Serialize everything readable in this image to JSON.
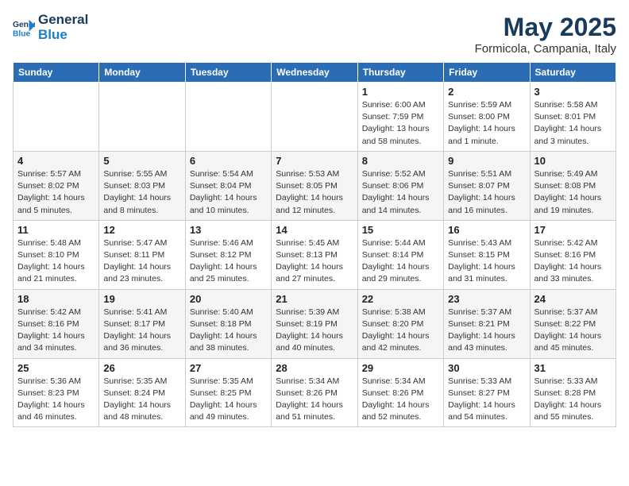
{
  "header": {
    "logo_text_general": "General",
    "logo_text_blue": "Blue",
    "month": "May 2025",
    "location": "Formicola, Campania, Italy"
  },
  "days_of_week": [
    "Sunday",
    "Monday",
    "Tuesday",
    "Wednesday",
    "Thursday",
    "Friday",
    "Saturday"
  ],
  "weeks": [
    [
      {
        "num": "",
        "info": ""
      },
      {
        "num": "",
        "info": ""
      },
      {
        "num": "",
        "info": ""
      },
      {
        "num": "",
        "info": ""
      },
      {
        "num": "1",
        "info": "Sunrise: 6:00 AM\nSunset: 7:59 PM\nDaylight: 13 hours\nand 58 minutes."
      },
      {
        "num": "2",
        "info": "Sunrise: 5:59 AM\nSunset: 8:00 PM\nDaylight: 14 hours\nand 1 minute."
      },
      {
        "num": "3",
        "info": "Sunrise: 5:58 AM\nSunset: 8:01 PM\nDaylight: 14 hours\nand 3 minutes."
      }
    ],
    [
      {
        "num": "4",
        "info": "Sunrise: 5:57 AM\nSunset: 8:02 PM\nDaylight: 14 hours\nand 5 minutes."
      },
      {
        "num": "5",
        "info": "Sunrise: 5:55 AM\nSunset: 8:03 PM\nDaylight: 14 hours\nand 8 minutes."
      },
      {
        "num": "6",
        "info": "Sunrise: 5:54 AM\nSunset: 8:04 PM\nDaylight: 14 hours\nand 10 minutes."
      },
      {
        "num": "7",
        "info": "Sunrise: 5:53 AM\nSunset: 8:05 PM\nDaylight: 14 hours\nand 12 minutes."
      },
      {
        "num": "8",
        "info": "Sunrise: 5:52 AM\nSunset: 8:06 PM\nDaylight: 14 hours\nand 14 minutes."
      },
      {
        "num": "9",
        "info": "Sunrise: 5:51 AM\nSunset: 8:07 PM\nDaylight: 14 hours\nand 16 minutes."
      },
      {
        "num": "10",
        "info": "Sunrise: 5:49 AM\nSunset: 8:08 PM\nDaylight: 14 hours\nand 19 minutes."
      }
    ],
    [
      {
        "num": "11",
        "info": "Sunrise: 5:48 AM\nSunset: 8:10 PM\nDaylight: 14 hours\nand 21 minutes."
      },
      {
        "num": "12",
        "info": "Sunrise: 5:47 AM\nSunset: 8:11 PM\nDaylight: 14 hours\nand 23 minutes."
      },
      {
        "num": "13",
        "info": "Sunrise: 5:46 AM\nSunset: 8:12 PM\nDaylight: 14 hours\nand 25 minutes."
      },
      {
        "num": "14",
        "info": "Sunrise: 5:45 AM\nSunset: 8:13 PM\nDaylight: 14 hours\nand 27 minutes."
      },
      {
        "num": "15",
        "info": "Sunrise: 5:44 AM\nSunset: 8:14 PM\nDaylight: 14 hours\nand 29 minutes."
      },
      {
        "num": "16",
        "info": "Sunrise: 5:43 AM\nSunset: 8:15 PM\nDaylight: 14 hours\nand 31 minutes."
      },
      {
        "num": "17",
        "info": "Sunrise: 5:42 AM\nSunset: 8:16 PM\nDaylight: 14 hours\nand 33 minutes."
      }
    ],
    [
      {
        "num": "18",
        "info": "Sunrise: 5:42 AM\nSunset: 8:16 PM\nDaylight: 14 hours\nand 34 minutes."
      },
      {
        "num": "19",
        "info": "Sunrise: 5:41 AM\nSunset: 8:17 PM\nDaylight: 14 hours\nand 36 minutes."
      },
      {
        "num": "20",
        "info": "Sunrise: 5:40 AM\nSunset: 8:18 PM\nDaylight: 14 hours\nand 38 minutes."
      },
      {
        "num": "21",
        "info": "Sunrise: 5:39 AM\nSunset: 8:19 PM\nDaylight: 14 hours\nand 40 minutes."
      },
      {
        "num": "22",
        "info": "Sunrise: 5:38 AM\nSunset: 8:20 PM\nDaylight: 14 hours\nand 42 minutes."
      },
      {
        "num": "23",
        "info": "Sunrise: 5:37 AM\nSunset: 8:21 PM\nDaylight: 14 hours\nand 43 minutes."
      },
      {
        "num": "24",
        "info": "Sunrise: 5:37 AM\nSunset: 8:22 PM\nDaylight: 14 hours\nand 45 minutes."
      }
    ],
    [
      {
        "num": "25",
        "info": "Sunrise: 5:36 AM\nSunset: 8:23 PM\nDaylight: 14 hours\nand 46 minutes."
      },
      {
        "num": "26",
        "info": "Sunrise: 5:35 AM\nSunset: 8:24 PM\nDaylight: 14 hours\nand 48 minutes."
      },
      {
        "num": "27",
        "info": "Sunrise: 5:35 AM\nSunset: 8:25 PM\nDaylight: 14 hours\nand 49 minutes."
      },
      {
        "num": "28",
        "info": "Sunrise: 5:34 AM\nSunset: 8:26 PM\nDaylight: 14 hours\nand 51 minutes."
      },
      {
        "num": "29",
        "info": "Sunrise: 5:34 AM\nSunset: 8:26 PM\nDaylight: 14 hours\nand 52 minutes."
      },
      {
        "num": "30",
        "info": "Sunrise: 5:33 AM\nSunset: 8:27 PM\nDaylight: 14 hours\nand 54 minutes."
      },
      {
        "num": "31",
        "info": "Sunrise: 5:33 AM\nSunset: 8:28 PM\nDaylight: 14 hours\nand 55 minutes."
      }
    ]
  ]
}
